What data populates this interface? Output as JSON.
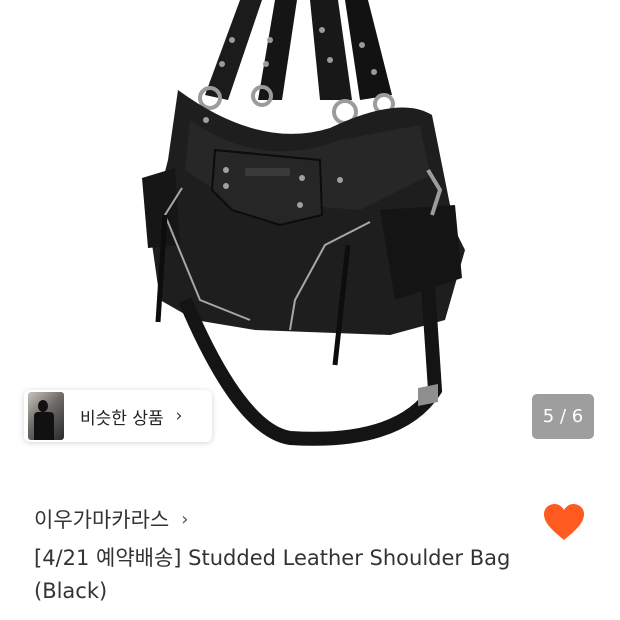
{
  "similar": {
    "label": "비슷한 상품",
    "chevron": "›"
  },
  "gallery": {
    "counter": "5 / 6",
    "current": 5,
    "total": 6
  },
  "product": {
    "brand": "이우가마카라스",
    "brand_chevron": "›",
    "title": "[4/21 예약배송] Studded Leather Shoulder Bag (Black)",
    "liked": true
  },
  "colors": {
    "heart": "#FF5A1F",
    "counter_bg": "#9E9E9E"
  },
  "icons": {
    "heart": "heart-icon",
    "chevron": "chevron-right-icon"
  }
}
